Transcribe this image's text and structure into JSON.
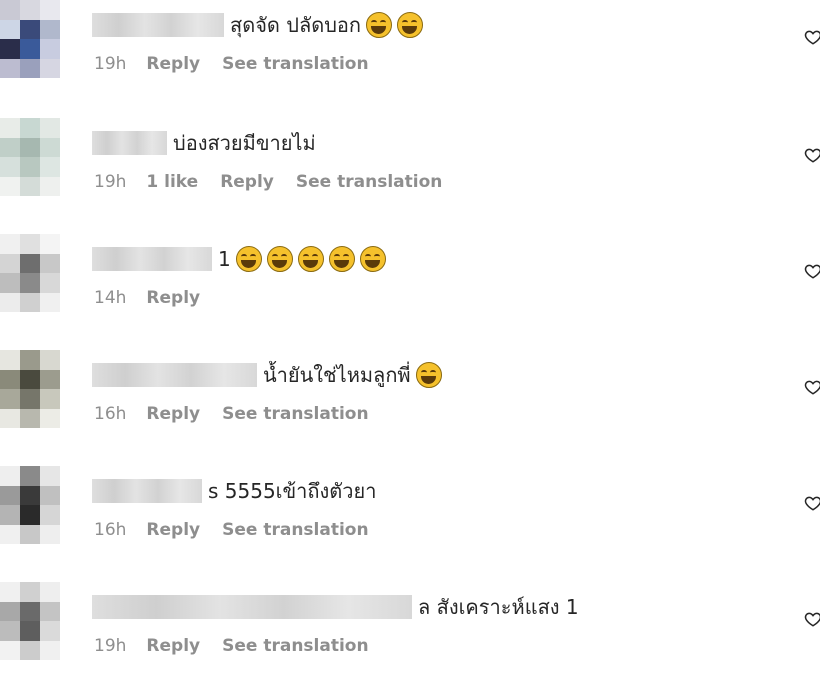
{
  "comments": [
    {
      "text": "สุดจัด ปลัดบอก",
      "emoji_count": 2,
      "time": "19h",
      "likes": "",
      "reply": "Reply",
      "translate": "See translation",
      "avatar": [
        "#c9c9d4",
        "#d8d8e0",
        "#e8e8ee",
        "#cdd6e6",
        "#3a4a7a",
        "#b0b8cc",
        "#2a2d4a",
        "#3a5a9a",
        "#c8cce0",
        "#bcbcd0",
        "#9aa0bc",
        "#d6d6e2"
      ]
    },
    {
      "text": "บ่องสวยมีขายไม่",
      "emoji_count": 0,
      "time": "19h",
      "likes": "1 like",
      "reply": "Reply",
      "translate": "See translation",
      "avatar": [
        "#e8ece8",
        "#c8d8d2",
        "#e2e8e4",
        "#c0cfc8",
        "#a6b8b0",
        "#cddad4",
        "#d6e0dc",
        "#b8c8c0",
        "#dde6e2",
        "#f0f2f0",
        "#d4dcd8",
        "#eef0ee"
      ]
    },
    {
      "text": "1",
      "emoji_count": 5,
      "time": "14h",
      "reply": "Reply",
      "translate": "",
      "avatar": [
        "#f0f0f0",
        "#e0e0e0",
        "#f4f4f4",
        "#d4d4d4",
        "#6e6e6e",
        "#c8c8c8",
        "#bdbdbd",
        "#8a8a8a",
        "#d8d8d8",
        "#ececec",
        "#d0d0d0",
        "#f0f0f0"
      ]
    },
    {
      "text": "น้ำยันใช่ไหมลูกพี่",
      "emoji_count": 1,
      "time": "16h",
      "likes": "",
      "reply": "Reply",
      "translate": "See translation",
      "avatar": [
        "#e6e6e0",
        "#9a9a8c",
        "#d8d8d0",
        "#8a8a7a",
        "#4a4a3e",
        "#9c9c8e",
        "#a8a89a",
        "#76766a",
        "#c8c8bc",
        "#e8e8e2",
        "#b8b8ae",
        "#ecece6"
      ]
    },
    {
      "text": "s 5555เข้าถึงตัวยา",
      "emoji_count": 0,
      "time": "16h",
      "likes": "",
      "reply": "Reply",
      "translate": "See translation",
      "avatar": [
        "#eeeeee",
        "#8a8a8a",
        "#e6e6e6",
        "#9a9a9a",
        "#3a3a3a",
        "#c0c0c0",
        "#b4b4b4",
        "#2a2a2a",
        "#d6d6d6",
        "#f0f0f0",
        "#c8c8c8",
        "#eeeeee"
      ]
    },
    {
      "text": "ล สังเคราะห์แสง 1",
      "emoji_count": 0,
      "time": "19h",
      "likes": "",
      "reply": "Reply",
      "translate": "See translation",
      "avatar": [
        "#f0f0f0",
        "#d0d0d0",
        "#eeeeee",
        "#a8a8a8",
        "#6a6a6a",
        "#c4c4c4",
        "#bcbcbc",
        "#5e5e5e",
        "#dadada",
        "#f2f2f2",
        "#cccccc",
        "#f0f0f0"
      ]
    }
  ],
  "colors": {
    "meta": "#8e8e8e",
    "text": "#262626",
    "emoji": "#f5c12c"
  },
  "icons": {
    "like": "heart-outline-icon",
    "emoji": "grinning-face-icon"
  }
}
